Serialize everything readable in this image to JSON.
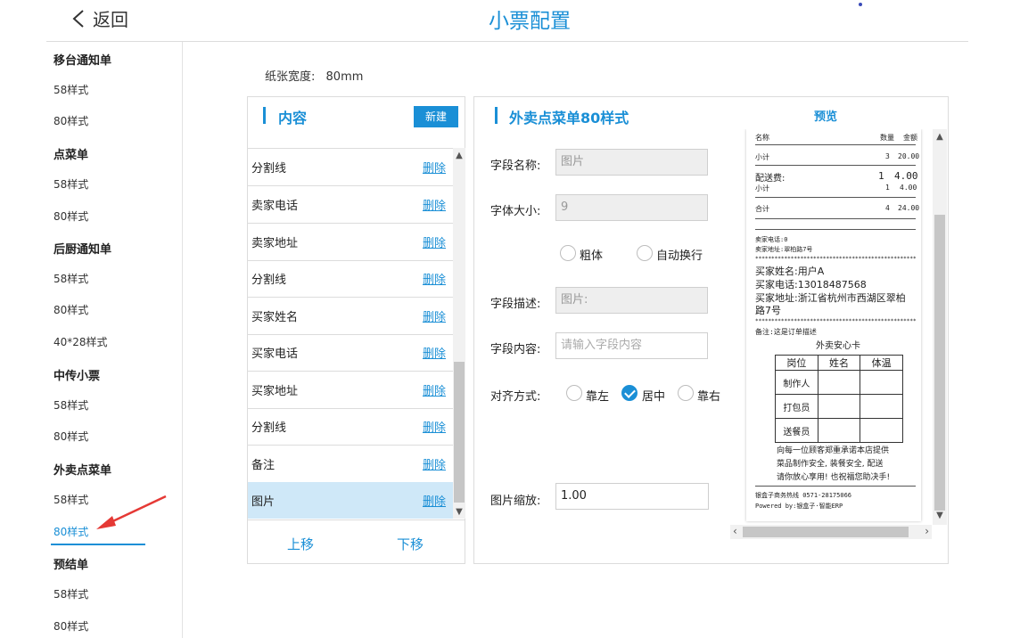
{
  "header": {
    "back_label": "返回",
    "title": "小票配置"
  },
  "sidebar": [
    {
      "label": "移台通知单",
      "group": true
    },
    {
      "label": "58样式"
    },
    {
      "label": "80样式"
    },
    {
      "label": "点菜单",
      "group": true
    },
    {
      "label": "58样式"
    },
    {
      "label": "80样式"
    },
    {
      "label": "后厨通知单",
      "group": true
    },
    {
      "label": "58样式"
    },
    {
      "label": "80样式"
    },
    {
      "label": "40*28样式"
    },
    {
      "label": "中传小票",
      "group": true
    },
    {
      "label": "58样式"
    },
    {
      "label": "80样式"
    },
    {
      "label": "外卖点菜单",
      "group": true
    },
    {
      "label": "58样式"
    },
    {
      "label": "80样式",
      "active": true
    },
    {
      "label": "预结单",
      "group": true
    },
    {
      "label": "58样式"
    },
    {
      "label": "80样式"
    }
  ],
  "paper": {
    "label": "纸张宽度:",
    "value": "80mm"
  },
  "content": {
    "title": "内容",
    "new_label": "新建",
    "delete_label": "删除",
    "items": [
      {
        "name": "分割线"
      },
      {
        "name": "卖家电话"
      },
      {
        "name": "卖家地址"
      },
      {
        "name": "分割线"
      },
      {
        "name": "买家姓名"
      },
      {
        "name": "买家电话"
      },
      {
        "name": "买家地址"
      },
      {
        "name": "分割线"
      },
      {
        "name": "备注"
      },
      {
        "name": "图片",
        "selected": true
      }
    ],
    "move_up": "上移",
    "move_down": "下移"
  },
  "settings": {
    "title": "外卖点菜单80样式",
    "field_name_label": "字段名称:",
    "field_name_value": "图片",
    "font_size_label": "字体大小:",
    "font_size_value": "9",
    "bold_label": "粗体",
    "wrap_label": "自动换行",
    "desc_label": "字段描述:",
    "desc_value": "图片:",
    "content_label": "字段内容:",
    "content_placeholder": "请输入字段内容",
    "align_label": "对齐方式:",
    "align_left": "靠左",
    "align_center": "居中",
    "align_right": "靠右",
    "align_selected": "居中",
    "scale_label": "图片缩放:",
    "scale_value": "1.00"
  },
  "preview": {
    "title": "预览",
    "col_name": "名称",
    "col_qty": "数量",
    "col_amount": "金额",
    "subtotal_label": "小计",
    "subtotal_qty": "3",
    "subtotal_amount": "20.00",
    "delivery_label": "配送费:",
    "delivery_qty": "1",
    "delivery_amount": "4.00",
    "delivery_sub_label": "小计",
    "delivery_sub_qty": "1",
    "delivery_sub_amount": "4.00",
    "total_label": "合计",
    "total_qty": "4",
    "total_amount": "24.00",
    "seller_phone": "卖家电话:0",
    "seller_addr": "卖家地址:翠柏路7号",
    "stars": "**************************************************",
    "buyer_name": "买家姓名:用户A",
    "buyer_phone": "买家电话:13018487568",
    "buyer_addr_1": "买家地址:浙江省杭州市西湖区翠柏",
    "buyer_addr_2": "路7号",
    "remark": "备注:这是订单描述",
    "card_title": "外卖安心卡",
    "card_headers": [
      "岗位",
      "姓名",
      "体温"
    ],
    "card_rows": [
      "制作人",
      "打包员",
      "送餐员"
    ],
    "card_text_1": "向每一位顾客郑重承诺本店提供",
    "card_text_2": "菜品制作安全, 装餐安全, 配送",
    "card_text_3": "请你放心享用! 也祝福您助决手!",
    "hotline": "银盒子商务热线 0571-28175066",
    "powered": "Powered by:银盒子·智能ERP"
  }
}
